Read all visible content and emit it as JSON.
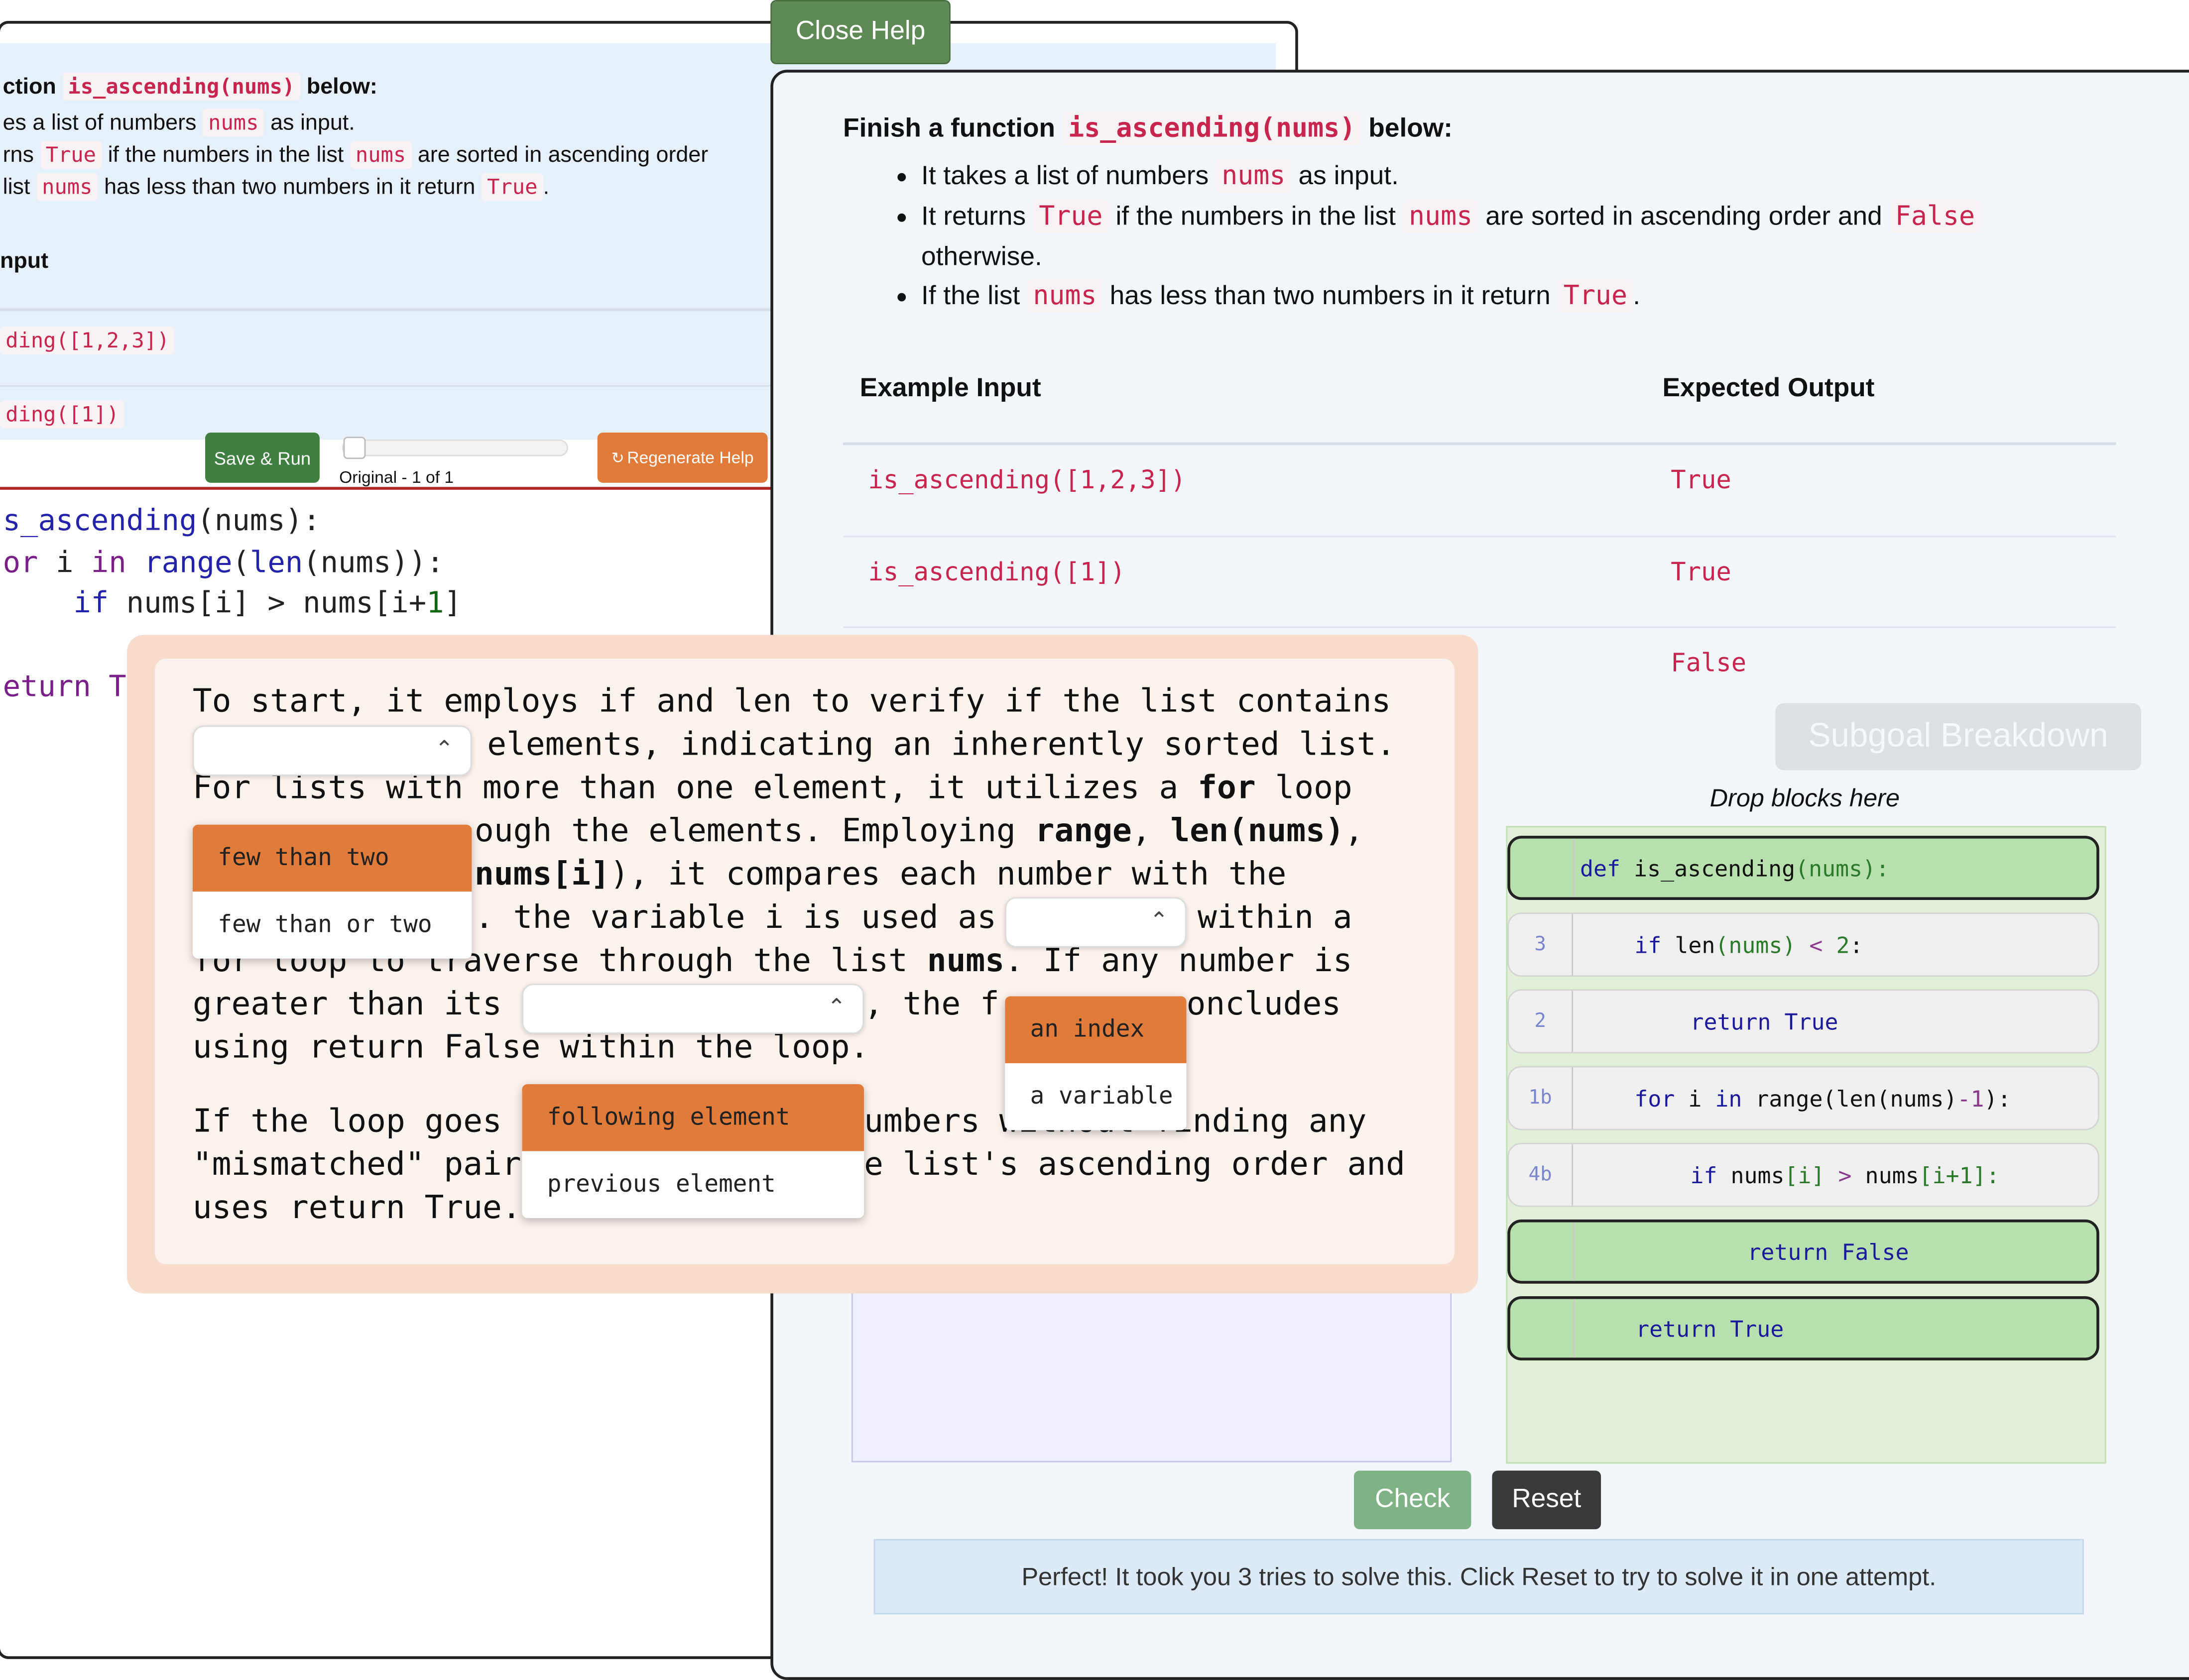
{
  "background_window": {
    "heading_prefix": "ction",
    "heading_func": "is_ascending(nums)",
    "heading_suffix": "below:",
    "bullet1_prefix": "es a list of numbers",
    "bullet1_code": "nums",
    "bullet1_suffix": "as input.",
    "bullet2_prefix": "rns",
    "bullet2_code1": "True",
    "bullet2_middle": "if the numbers in the list",
    "bullet2_code2": "nums",
    "bullet2_suffix": "are sorted in ascending order",
    "bullet3_prefix": "list",
    "bullet3_code1": "nums",
    "bullet3_middle": "has less than two numbers in it return",
    "bullet3_code2": "True",
    "bullet3_end": ".",
    "table_header": "nput",
    "row1": "ding([1,2,3])",
    "row2": "ding([1])",
    "save_run_label": "Save & Run",
    "regenerate_label": "Regenerate Help",
    "version_label": "Original - 1 of 1",
    "code_lines": [
      {
        "a": "s_ascending",
        "b": "(nums):"
      },
      {
        "a": "or",
        "b": " i ",
        "c": "in",
        "d": " range",
        "e": "(",
        "f": "len",
        "g": "(nums)):"
      },
      {
        "a": "    if",
        "b": " nums[i] > nums[i+",
        "c": "1",
        "d": "]"
      },
      {
        "a": "eturn Tr"
      }
    ]
  },
  "help_window": {
    "close_label": "Close Help",
    "heading_prefix": "Finish a function",
    "heading_func": "is_ascending(nums)",
    "heading_suffix": "below:",
    "bullets": {
      "b1_prefix": "It takes a list of numbers",
      "b1_code": "nums",
      "b1_suffix": "as input.",
      "b2_prefix": "It returns",
      "b2_code1": "True",
      "b2_middle": "if the numbers in the list",
      "b2_code2": "nums",
      "b2_mid2": "are sorted in ascending order and",
      "b2_code3": "False",
      "b2_cont": "otherwise.",
      "b3_prefix": "If the list",
      "b3_code": "nums",
      "b3_middle": "has less than two numbers in it return",
      "b3_code2": "True",
      "b3_end": "."
    },
    "table": {
      "col_input": "Example Input",
      "col_output": "Expected Output",
      "rows": [
        {
          "input": "is_ascending([1,2,3])",
          "output": "True"
        },
        {
          "input": "is_ascending([1])",
          "output": "True"
        },
        {
          "input": "",
          "output": "False"
        }
      ]
    },
    "subgoal_label": "Subgoal Breakdown",
    "drop_label": "Drop blocks here",
    "blocks": [
      {
        "num": "",
        "style": "green"
      },
      {
        "num": "3",
        "style": "gray"
      },
      {
        "num": "2",
        "style": "gray"
      },
      {
        "num": "1b",
        "style": "gray"
      },
      {
        "num": "4b",
        "style": "gray"
      },
      {
        "num": "",
        "style": "green"
      },
      {
        "num": "",
        "style": "green"
      }
    ],
    "block_code": {
      "b0_kw": "def",
      "b0_rest": " is_ascending",
      "b0_paren": "(nums):",
      "b1_kw": "if",
      "b1_a": " len",
      "b1_b": "(nums) ",
      "b1_op": "<",
      "b1_n": " 2",
      "b1_c": ":",
      "b2_kw": "return",
      "b2_val": " True",
      "b3_kw": "for",
      "b3_a": " i ",
      "b3_in": "in",
      "b3_b": " range",
      "b3_c": "(len(nums)",
      "b3_op": "-1",
      "b3_d": "):",
      "b4_kw": "if",
      "b4_a": " nums",
      "b4_b": "[i]",
      "b4_op": " >",
      "b4_c": " nums",
      "b4_d": "[i+",
      "b4_n": "1",
      "b4_e": "]:",
      "b5_kw": "return",
      "b5_val": " False",
      "b6_kw": "return",
      "b6_val": " True"
    },
    "check_label": "Check",
    "reset_label": "Reset",
    "feedback": "Perfect! It took you 3 tries to solve this. Click Reset to try to solve it in one attempt."
  },
  "popup": {
    "lines": {
      "l1": "To start, it employs if and len to verify if the list contains",
      "l2": "elements, indicating an inherently sorted list.",
      "l3a": "For lists with more than one element, it utilizes a ",
      "l3b": "for",
      "l3c": " loop",
      "l4a": "ough the elements. Employing ",
      "l4b": "range",
      "l4c": ", ",
      "l4d": "len(nums)",
      "l4e": ",",
      "l5a": "nums[i]",
      "l5b": "), it compares each number with the",
      "l6a": ". the variable i is used as",
      "l6b": "within a",
      "l7a": "for loop to traverse through the list ",
      "l7b": "nums",
      "l7c": ". If any number is",
      "l8a": "greater than its",
      "l8b": ", the f",
      "l8c": "oncludes",
      "l9": "using return False within the loop.",
      "l10a": "If the loop goes",
      "l10b": "umbers without finding any",
      "l11a": "\"mismatched\" pair",
      "l11b": "e list's ascending order and",
      "l12": "uses return True."
    },
    "dropdown1_options": [
      "few than two",
      "few than or two"
    ],
    "dropdown2_options": [
      "an index",
      "a variable"
    ],
    "dropdown3_options": [
      "following element",
      "previous element"
    ]
  },
  "colors": {
    "accent_orange": "#e07b39",
    "close_green": "#5f8a55",
    "check_green": "#7fb386",
    "code_red": "#c7254e"
  }
}
